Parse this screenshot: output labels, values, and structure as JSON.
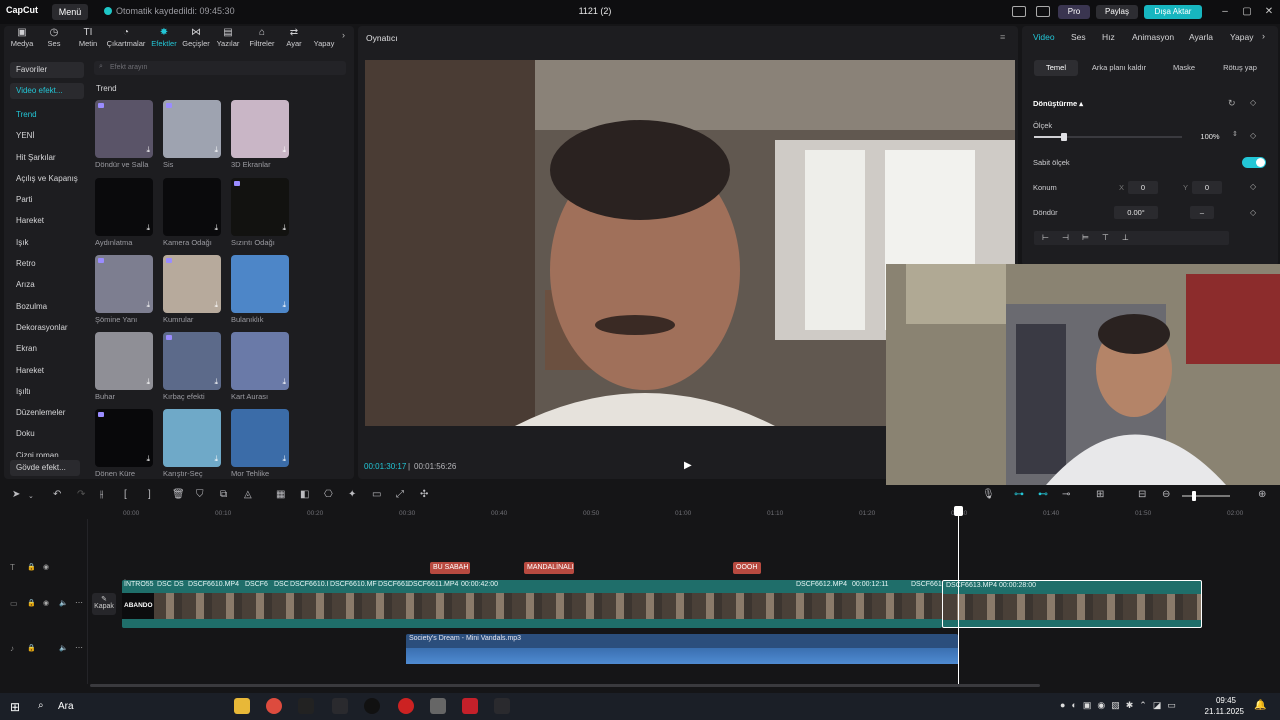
{
  "app": {
    "logo": "CapCut",
    "menu_label": "Menü",
    "save_status": "Otomatik kaydedildi: 09:45:30",
    "window_title": "1121 (2)",
    "pro_label": "Pro",
    "share_label": "Paylaş",
    "export_label": "Dışa Aktar"
  },
  "tools": [
    "Medya",
    "Ses",
    "Metin",
    "Çıkartmalar",
    "Efektler",
    "Geçişler",
    "Yazılar",
    "Filtreler",
    "Ayar",
    "Yapay"
  ],
  "active_tool": "Efektler",
  "categories": {
    "favorites": "Favoriler",
    "video_effects": "Video efekt...",
    "items": [
      "Trend",
      "YENİ",
      "Hit Şarkılar",
      "Açılış ve Kapanış",
      "Parti",
      "Hareket",
      "Işık",
      "Retro",
      "Arıza",
      "Bozulma",
      "Dekorasyonlar",
      "Ekran",
      "Hareket",
      "Işıltı",
      "Düzenlemeler",
      "Doku",
      "Çizgi roman"
    ],
    "body_effects": "Gövde efekt..."
  },
  "search": {
    "placeholder": "Efekt arayın"
  },
  "section_title": "Trend",
  "effects": [
    {
      "label": "Döndür ve Salla",
      "color": "#5a5468"
    },
    {
      "label": "Sis",
      "color": "#9ea3b0"
    },
    {
      "label": "3D Ekranlar",
      "color": "#c9b6c6"
    },
    {
      "label": "Aydınlatma",
      "color": "#0a0a0c"
    },
    {
      "label": "Kamera Odağı",
      "color": "#0a0a0c"
    },
    {
      "label": "Sızıntı Odağı",
      "color": "#121210"
    },
    {
      "label": "Şömine Yanı",
      "color": "#7d7e90"
    },
    {
      "label": "Kumrular",
      "color": "#b7aa9c"
    },
    {
      "label": "Bulanıklık",
      "color": "#4d86c8"
    },
    {
      "label": "Buhar",
      "color": "#8f8f96"
    },
    {
      "label": "Kırbaç efekti",
      "color": "#5c6a8a"
    },
    {
      "label": "Kart Aurası",
      "color": "#6a7aa8"
    },
    {
      "label": "Dönen Küre",
      "color": "#08080a"
    },
    {
      "label": "Karıştır-Seç",
      "color": "#6fa9c8"
    },
    {
      "label": "Mor Tehlike",
      "color": "#3b6ca8"
    }
  ],
  "player": {
    "title": "Oynatıcı",
    "current_time": "00:01:30:17",
    "total_time": "00:01:56:26"
  },
  "right_tabs": [
    "Video",
    "Ses",
    "Hız",
    "Animasyon",
    "Ayarla",
    "Yapay"
  ],
  "right_subtabs": [
    "Temel",
    "Arka planı kaldır",
    "Maske",
    "Rötuş yap"
  ],
  "transform": {
    "header": "Dönüştürme",
    "scale_label": "Ölçek",
    "scale_value": "100%",
    "scale_fraction": 0.2,
    "uniform_label": "Sabit ölçek",
    "position_label": "Konum",
    "pos_x_label": "X",
    "pos_x": "0",
    "pos_y_label": "Y",
    "pos_y": "0",
    "rotate_label": "Döndür",
    "rotate_value": "0.00°",
    "rotate_dash": "–"
  },
  "ruler": [
    "00:00",
    "00:10",
    "00:20",
    "00:30",
    "00:40",
    "00:50",
    "01:00",
    "01:10",
    "01:20",
    "01:30",
    "01:40",
    "01:50",
    "02:00"
  ],
  "text_clips": [
    "BU SABAH",
    "MANDALİNALI",
    "OOOH"
  ],
  "track_cover_label": "Kapak",
  "clips": {
    "intro": "İNTRO55",
    "intro_text": "ABANDO",
    "c1": "DSC",
    "c2": "DS",
    "c3": "DSCF6610.MP4",
    "c4": "DSCF6",
    "c5": "DSC",
    "c6": "DSCF6610.I",
    "c7": "DSCF6610.MF",
    "c8": "DSCF661",
    "c9": "DSCF6611.MP4",
    "c9_time": "00:00:42:00",
    "c10": "DSCF6612.MP4",
    "c10_time": "00:00:12:11",
    "c11": "DSCF661",
    "c12": "DSCF6613.MP4",
    "c12_time": "00:00:28:00"
  },
  "audio_clip": "Society's Dream - Mini Vandals.mp3",
  "taskbar": {
    "search": "Ara",
    "time": "09:45",
    "date": "21.11.2025"
  }
}
